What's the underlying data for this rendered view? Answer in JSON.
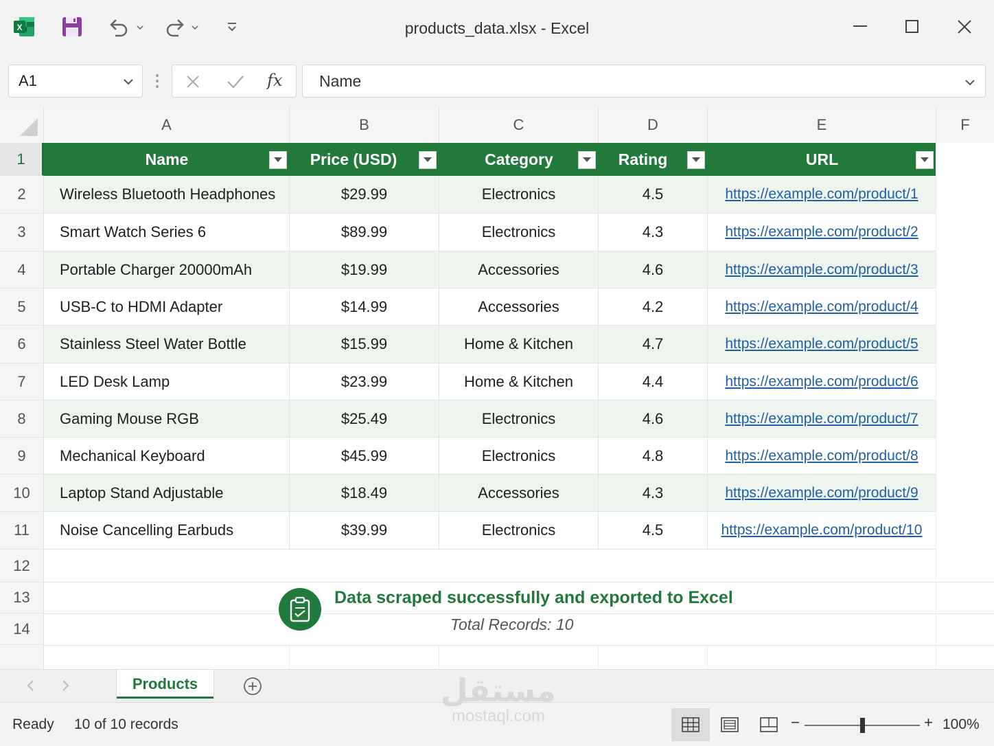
{
  "window": {
    "title": "products_data.xlsx - Excel",
    "app_icon": "excel-icon"
  },
  "formula_bar": {
    "name_box": "A1",
    "fx_label": "fx",
    "formula_value": "Name"
  },
  "columns": [
    "A",
    "B",
    "C",
    "D",
    "E",
    "F"
  ],
  "rows": [
    "1",
    "2",
    "3",
    "4",
    "5",
    "6",
    "7",
    "8",
    "9",
    "10",
    "11",
    "12",
    "13",
    "14"
  ],
  "table": {
    "headers": [
      "Name",
      "Price (USD)",
      "Category",
      "Rating",
      "URL"
    ],
    "rows": [
      [
        "Wireless Bluetooth Headphones",
        "$29.99",
        "Electronics",
        "4.5",
        "https://example.com/product/1"
      ],
      [
        "Smart Watch Series 6",
        "$89.99",
        "Electronics",
        "4.3",
        "https://example.com/product/2"
      ],
      [
        "Portable Charger 20000mAh",
        "$19.99",
        "Accessories",
        "4.6",
        "https://example.com/product/3"
      ],
      [
        "USB-C to HDMI Adapter",
        "$14.99",
        "Accessories",
        "4.2",
        "https://example.com/product/4"
      ],
      [
        "Stainless Steel Water Bottle",
        "$15.99",
        "Home & Kitchen",
        "4.7",
        "https://example.com/product/5"
      ],
      [
        "LED Desk Lamp",
        "$23.99",
        "Home & Kitchen",
        "4.4",
        "https://example.com/product/6"
      ],
      [
        "Gaming Mouse RGB",
        "$25.49",
        "Electronics",
        "4.6",
        "https://example.com/product/7"
      ],
      [
        "Mechanical Keyboard",
        "$45.99",
        "Electronics",
        "4.8",
        "https://example.com/product/8"
      ],
      [
        "Laptop Stand Adjustable",
        "$18.49",
        "Accessories",
        "4.3",
        "https://example.com/product/9"
      ],
      [
        "Noise Cancelling Earbuds",
        "$39.99",
        "Electronics",
        "4.5",
        "https://example.com/product/10"
      ]
    ]
  },
  "notice": {
    "title": "Data scraped successfully and exported to Excel",
    "subtitle": "Total Records: 10",
    "icon": "clipboard-check-icon"
  },
  "sheets": {
    "active": "Products"
  },
  "status": {
    "state": "Ready",
    "records": "10 of 10 records",
    "zoom": "100%",
    "zoom_fraction": 0.5
  },
  "watermark": {
    "arabic": "مستقل",
    "latin": "mostaql.com"
  },
  "colors": {
    "accent": "#217a3b",
    "link": "#1f5fa8",
    "band": "#eef5ee"
  }
}
